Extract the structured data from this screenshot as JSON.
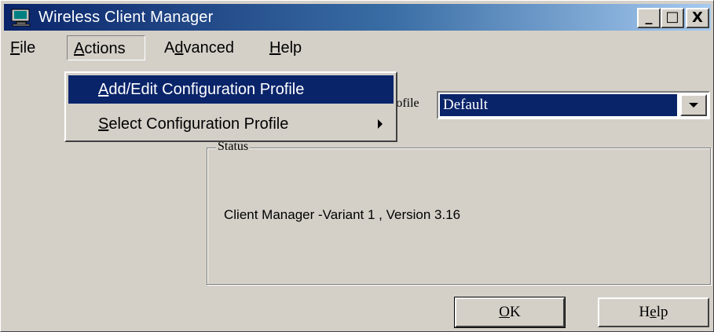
{
  "window": {
    "title": "Wireless Client Manager"
  },
  "caption_buttons": {
    "minimize": "_",
    "maximize": "□",
    "close": "X"
  },
  "menu": {
    "file": {
      "accel": "F",
      "rest": "ile"
    },
    "actions": {
      "accel": "A",
      "rest": "ctions"
    },
    "advanced": {
      "pre": "A",
      "accel": "d",
      "rest": "vanced"
    },
    "help": {
      "accel": "H",
      "rest": "elp"
    }
  },
  "actions_menu": {
    "items": [
      {
        "accel": "A",
        "rest": "dd/Edit Configuration Profile",
        "submenu": false
      },
      {
        "accel": "S",
        "rest": "elect Configuration Profile",
        "submenu": true
      }
    ]
  },
  "profile": {
    "label": "rofile",
    "selected": "Default"
  },
  "status": {
    "legend": "Status",
    "text": "Client Manager -Variant 1 , Version 3.16"
  },
  "buttons": {
    "ok": {
      "accel": "O",
      "rest": "K"
    },
    "help": {
      "pre": "H",
      "accel": "e",
      "rest": "lp"
    }
  },
  "colors": {
    "title_gradient_start": "#0a246a",
    "title_gradient_end": "#a6caf0",
    "selection": "#0a246a",
    "face": "#d4d0c8"
  }
}
